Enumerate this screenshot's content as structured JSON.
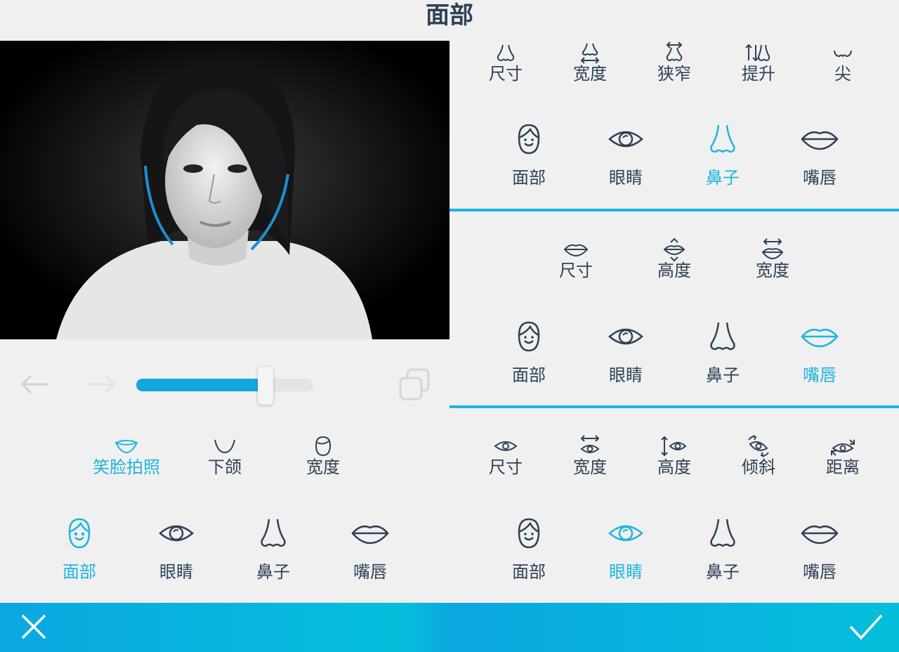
{
  "title": "面部",
  "left_panel": {
    "sub_tools": [
      {
        "label": "笑脸拍照",
        "icon": "smile-lips-icon",
        "active": true
      },
      {
        "label": "下颌",
        "icon": "jaw-icon",
        "active": false
      },
      {
        "label": "宽度",
        "icon": "face-width-icon",
        "active": false
      }
    ],
    "categories": [
      {
        "label": "面部",
        "icon": "face-icon",
        "active": true
      },
      {
        "label": "眼睛",
        "icon": "eye-icon",
        "active": false
      },
      {
        "label": "鼻子",
        "icon": "nose-icon",
        "active": false
      },
      {
        "label": "嘴唇",
        "icon": "lips-icon",
        "active": false
      }
    ],
    "slider": {
      "level_percent": 73
    }
  },
  "right_panels": [
    {
      "sub_tools": [
        {
          "label": "尺寸",
          "icon": "nose-size-icon"
        },
        {
          "label": "宽度",
          "icon": "nose-width-icon"
        },
        {
          "label": "狭窄",
          "icon": "nose-narrow-icon"
        },
        {
          "label": "提升",
          "icon": "nose-lift-icon"
        },
        {
          "label": "尖",
          "icon": "nose-tip-icon"
        }
      ],
      "categories": [
        {
          "label": "面部",
          "icon": "face-icon",
          "active": false
        },
        {
          "label": "眼睛",
          "icon": "eye-icon",
          "active": false
        },
        {
          "label": "鼻子",
          "icon": "nose-icon",
          "active": true
        },
        {
          "label": "嘴唇",
          "icon": "lips-icon",
          "active": false
        }
      ]
    },
    {
      "sub_tools": [
        {
          "label": "尺寸",
          "icon": "lips-size-icon"
        },
        {
          "label": "高度",
          "icon": "lips-height-icon"
        },
        {
          "label": "宽度",
          "icon": "lips-width-icon"
        }
      ],
      "categories": [
        {
          "label": "面部",
          "icon": "face-icon",
          "active": false
        },
        {
          "label": "眼睛",
          "icon": "eye-icon",
          "active": false
        },
        {
          "label": "鼻子",
          "icon": "nose-icon",
          "active": false
        },
        {
          "label": "嘴唇",
          "icon": "lips-icon",
          "active": true
        }
      ]
    },
    {
      "sub_tools": [
        {
          "label": "尺寸",
          "icon": "eye-size-icon"
        },
        {
          "label": "宽度",
          "icon": "eye-width-icon"
        },
        {
          "label": "高度",
          "icon": "eye-height-icon"
        },
        {
          "label": "倾斜",
          "icon": "eye-tilt-icon"
        },
        {
          "label": "距离",
          "icon": "eye-distance-icon"
        }
      ],
      "categories": [
        {
          "label": "面部",
          "icon": "face-icon",
          "active": false
        },
        {
          "label": "眼睛",
          "icon": "eye-icon",
          "active": true
        },
        {
          "label": "鼻子",
          "icon": "nose-icon",
          "active": false
        },
        {
          "label": "嘴唇",
          "icon": "lips-icon",
          "active": false
        }
      ]
    }
  ],
  "colors": {
    "accent": "#1eb5de",
    "icon": "#2f4156",
    "bar": "#0aa8e0"
  }
}
